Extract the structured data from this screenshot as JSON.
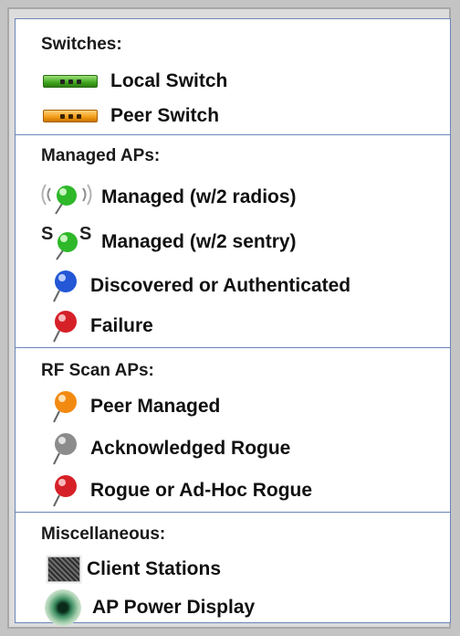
{
  "sections": {
    "switches": {
      "title": "Switches:",
      "items": [
        {
          "label": "Local Switch",
          "icon": "local-switch-icon",
          "color": "#3fa61d"
        },
        {
          "label": "Peer Switch",
          "icon": "peer-switch-icon",
          "color": "#f29b16"
        }
      ]
    },
    "managed_aps": {
      "title": "Managed APs:",
      "items": [
        {
          "label": "Managed (w/2 radios)",
          "icon": "green-pin-radio-icon",
          "color": "#2fb82a"
        },
        {
          "label": "Managed (w/2 sentry)",
          "icon": "green-pin-sentry-icon",
          "color": "#2fb82a",
          "sentry_glyph": "S"
        },
        {
          "label": "Discovered or Authenticated",
          "icon": "blue-pin-icon",
          "color": "#2357d6"
        },
        {
          "label": "Failure",
          "icon": "red-pin-icon",
          "color": "#d62028"
        }
      ]
    },
    "rf_scan_aps": {
      "title": "RF Scan APs:",
      "items": [
        {
          "label": "Peer Managed",
          "icon": "orange-pin-icon",
          "color": "#f28a12"
        },
        {
          "label": "Acknowledged Rogue",
          "icon": "gray-pin-icon",
          "color": "#8c8c8c"
        },
        {
          "label": "Rogue or Ad-Hoc Rogue",
          "icon": "red-pin-icon",
          "color": "#d62028"
        }
      ]
    },
    "miscellaneous": {
      "title": "Miscellaneous:",
      "items": [
        {
          "label": "Client Stations",
          "icon": "client-station-icon"
        },
        {
          "label": "AP Power Display",
          "icon": "ap-power-display-icon"
        }
      ]
    }
  }
}
